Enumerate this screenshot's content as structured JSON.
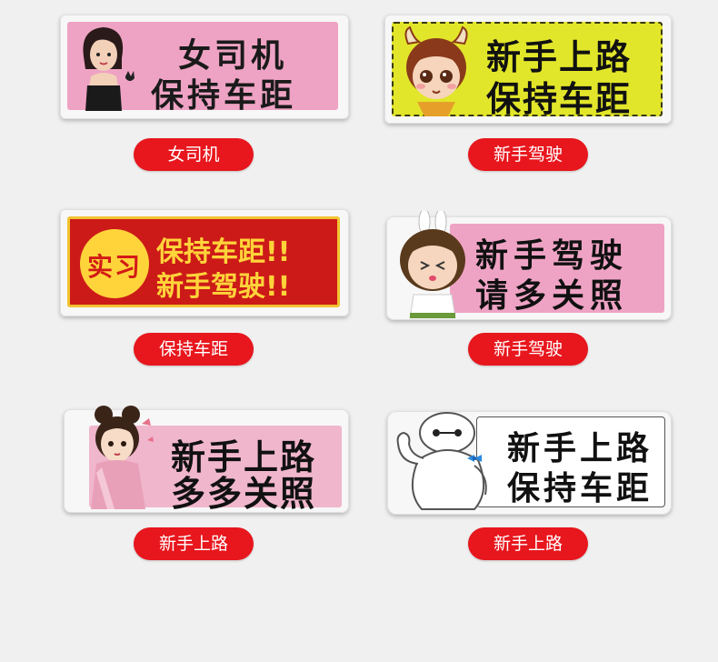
{
  "products": [
    {
      "label": "女司机",
      "line1": "女司机",
      "line2": "保持车距"
    },
    {
      "label": "新手驾驶",
      "line1": "新手上路",
      "line2": "保持车距"
    },
    {
      "label": "保持车距",
      "badge": "实习",
      "line1": "保持车距!!",
      "line2": "新手驾驶!!"
    },
    {
      "label": "新手驾驶",
      "line1": "新手驾驶",
      "line2": "请多关照"
    },
    {
      "label": "新手上路",
      "line1": "新手上路",
      "line2": "多多关照"
    },
    {
      "label": "新手上路",
      "line1": "新手上路",
      "line2": "保持车距"
    }
  ],
  "colors": {
    "pill": "#e8161d",
    "pink_panel": "#efa3c4",
    "yellow_panel": "#e2e62a",
    "red_panel": "#cc1a18",
    "gold": "#ffd43a"
  },
  "icons": [
    "woman-illustration",
    "girl-with-horns-illustration",
    "girl-bunny-ears-illustration",
    "ancient-lady-illustration",
    "robot-character-illustration"
  ]
}
